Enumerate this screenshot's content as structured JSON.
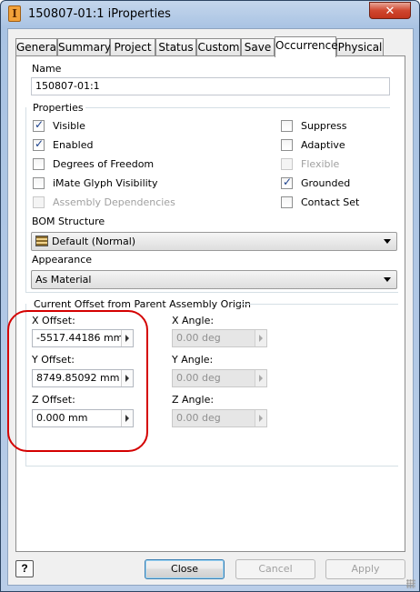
{
  "window": {
    "title": "150807-01:1 iProperties",
    "close_glyph": "✕",
    "icon_letter": "I"
  },
  "tabs": [
    {
      "label": "General"
    },
    {
      "label": "Summary"
    },
    {
      "label": "Project"
    },
    {
      "label": "Status"
    },
    {
      "label": "Custom"
    },
    {
      "label": "Save"
    },
    {
      "label": "Occurrence",
      "active": true
    },
    {
      "label": "Physical"
    }
  ],
  "name": {
    "label": "Name",
    "value": "150807-01:1"
  },
  "properties": {
    "group_label": "Properties",
    "left": [
      {
        "label": "Visible",
        "checked": true,
        "enabled": true
      },
      {
        "label": "Enabled",
        "checked": true,
        "enabled": true
      },
      {
        "label": "Degrees of Freedom",
        "checked": false,
        "enabled": true
      },
      {
        "label": "iMate Glyph Visibility",
        "checked": false,
        "enabled": true
      },
      {
        "label": "Assembly Dependencies",
        "checked": false,
        "enabled": false
      }
    ],
    "right": [
      {
        "label": "Suppress",
        "checked": false,
        "enabled": true
      },
      {
        "label": "Adaptive",
        "checked": false,
        "enabled": true
      },
      {
        "label": "Flexible",
        "checked": false,
        "enabled": false
      },
      {
        "label": "Grounded",
        "checked": true,
        "enabled": true
      },
      {
        "label": "Contact Set",
        "checked": false,
        "enabled": true
      }
    ],
    "bom_label": "BOM Structure",
    "bom_value": "Default (Normal)",
    "appearance_label": "Appearance",
    "appearance_value": "As Material"
  },
  "offset": {
    "group_label": "Current Offset from Parent Assembly Origin",
    "x_offset_label": "X Offset:",
    "x_offset_value": "-5517.44186 mm",
    "y_offset_label": "Y Offset:",
    "y_offset_value": "8749.85092 mm",
    "z_offset_label": "Z Offset:",
    "z_offset_value": "0.000 mm",
    "x_angle_label": "X Angle:",
    "x_angle_value": "0.00 deg",
    "y_angle_label": "Y Angle:",
    "y_angle_value": "0.00 deg",
    "z_angle_label": "Z Angle:",
    "z_angle_value": "0.00 deg"
  },
  "buttons": {
    "help": "?",
    "close": "Close",
    "cancel": "Cancel",
    "apply": "Apply"
  },
  "colors": {
    "annotation_circle": "#d40000"
  }
}
